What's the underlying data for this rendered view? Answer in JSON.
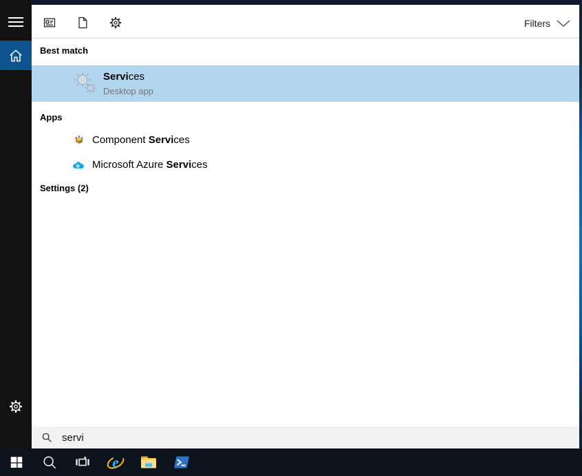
{
  "topbar": {
    "icons": [
      {
        "name": "apps-filter-icon"
      },
      {
        "name": "documents-filter-icon"
      },
      {
        "name": "settings-filter-icon"
      }
    ],
    "filters_label": "Filters"
  },
  "sidebar": {
    "menu_icon": "hamburger-menu-icon",
    "home_icon": "home-icon",
    "settings_icon": "gear-icon"
  },
  "results": {
    "best_match": {
      "header": "Best match",
      "item": {
        "icon": "services-gears-icon",
        "title_match": "Servi",
        "title_rest": "ces",
        "subtitle": "Desktop app",
        "selected": true
      }
    },
    "apps": {
      "header": "Apps",
      "items": [
        {
          "icon": "component-services-icon",
          "prefix": "Component ",
          "match": "Servi",
          "rest": "ces"
        },
        {
          "icon": "azure-services-icon",
          "prefix": "Microsoft Azure ",
          "match": "Servi",
          "rest": "ces"
        }
      ]
    },
    "settings": {
      "header": "Settings (2)"
    }
  },
  "search_box": {
    "icon": "search-icon",
    "value": "servi"
  },
  "taskbar": {
    "buttons": [
      {
        "icon": "windows-start-icon"
      },
      {
        "icon": "search-icon"
      },
      {
        "icon": "task-view-icon"
      },
      {
        "icon": "internet-explorer-icon"
      },
      {
        "icon": "file-explorer-icon"
      },
      {
        "icon": "powershell-icon"
      }
    ]
  },
  "colors": {
    "selection_highlight": "#b3d6ef",
    "home_tile_accent": "#0d5390",
    "sidebar_bg": "#121212",
    "taskbar_bg": "#0d131d",
    "desktop_edge_blue": "#1b6cae",
    "subtitle_gray": "#757575",
    "search_bar_bg": "#f2f2f2"
  }
}
